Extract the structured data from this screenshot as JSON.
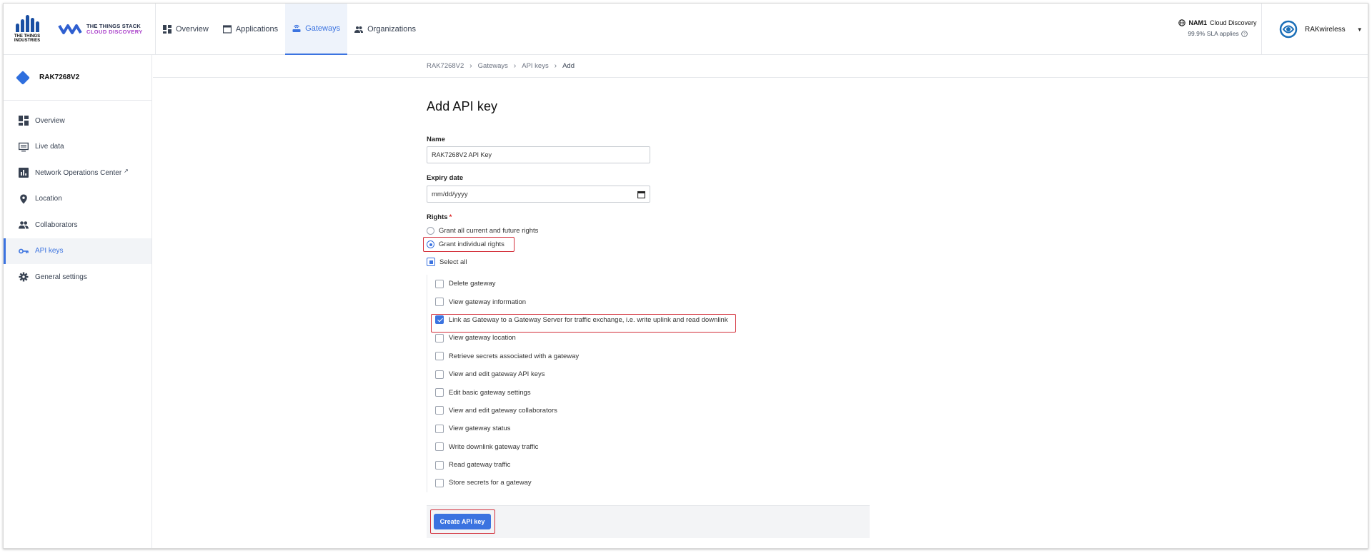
{
  "brand": {
    "tti_text": "THE THINGS INDUSTRIES",
    "stack_line1": "THE THINGS STACK",
    "stack_line2": "CLOUD DISCOVERY"
  },
  "topnav": [
    {
      "label": "Overview",
      "icon": "dashboard-icon"
    },
    {
      "label": "Applications",
      "icon": "window-icon"
    },
    {
      "label": "Gateways",
      "icon": "router-icon",
      "active": true
    },
    {
      "label": "Organizations",
      "icon": "people-icon"
    }
  ],
  "cluster": {
    "name": "NAM1",
    "label": "Cloud Discovery",
    "sla": "99.9% SLA applies"
  },
  "user": {
    "name": "RAKwireless"
  },
  "sidebar": {
    "gateway_name": "RAK7268V2",
    "items": [
      {
        "label": "Overview",
        "icon": "dashboard-icon"
      },
      {
        "label": "Live data",
        "icon": "list-icon"
      },
      {
        "label": "Network Operations Center",
        "icon": "bar-chart-icon",
        "external": true
      },
      {
        "label": "Location",
        "icon": "location-pin-icon"
      },
      {
        "label": "Collaborators",
        "icon": "people-icon"
      },
      {
        "label": "API keys",
        "icon": "key-icon",
        "active": true
      },
      {
        "label": "General settings",
        "icon": "gear-icon"
      }
    ]
  },
  "breadcrumb": [
    "RAK7268V2",
    "Gateways",
    "API keys",
    "Add"
  ],
  "form": {
    "title": "Add API key",
    "name_label": "Name",
    "name_value": "RAK7268V2 API Key",
    "expiry_label": "Expiry date",
    "expiry_placeholder": "mm/dd/yyyy",
    "rights_label": "Rights",
    "rights_required": "*",
    "radio_all": "Grant all current and future rights",
    "radio_individual": "Grant individual rights",
    "select_all": "Select all",
    "rights": [
      {
        "label": "Delete gateway",
        "checked": false
      },
      {
        "label": "View gateway information",
        "checked": false
      },
      {
        "label": "Link as Gateway to a Gateway Server for traffic exchange, i.e. write uplink and read downlink",
        "checked": true
      },
      {
        "label": "View gateway location",
        "checked": false
      },
      {
        "label": "Retrieve secrets associated with a gateway",
        "checked": false
      },
      {
        "label": "View and edit gateway API keys",
        "checked": false
      },
      {
        "label": "Edit basic gateway settings",
        "checked": false
      },
      {
        "label": "View and edit gateway collaborators",
        "checked": false
      },
      {
        "label": "View gateway status",
        "checked": false
      },
      {
        "label": "Write downlink gateway traffic",
        "checked": false
      },
      {
        "label": "Read gateway traffic",
        "checked": false
      },
      {
        "label": "Store secrets for a gateway",
        "checked": false
      }
    ],
    "submit_label": "Create API key"
  },
  "colors": {
    "accent": "#3b73e0",
    "highlight": "#d32f3a"
  }
}
